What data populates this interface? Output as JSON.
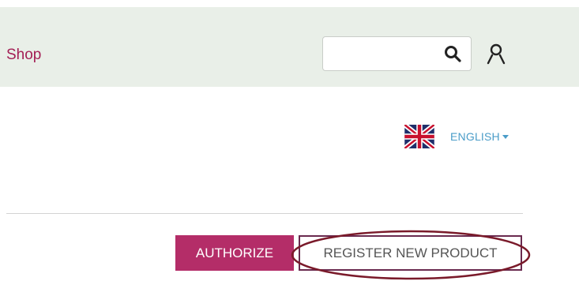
{
  "header": {
    "shop_label": "Shop",
    "search": {
      "value": "",
      "placeholder": ""
    },
    "icons": {
      "search": "search-icon",
      "user": "user-icon"
    }
  },
  "language": {
    "label": "ENGLISH",
    "flag": "uk-flag-icon"
  },
  "actions": {
    "authorize_label": "AUTHORIZE",
    "register_label": "REGISTER NEW PRODUCT"
  },
  "colors": {
    "header_bg": "#e9efe8",
    "brand": "#a31f55",
    "authorize_bg": "#b42d68",
    "link_blue": "#4a9cc8",
    "annotation": "#7a1a2a"
  }
}
